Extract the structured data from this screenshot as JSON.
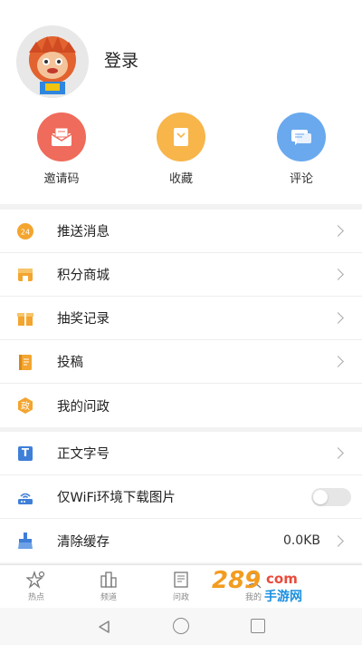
{
  "profile": {
    "login_label": "登录"
  },
  "quick_actions": [
    {
      "label": "邀请码",
      "icon": "envelope-icon",
      "color": "#ef6b5b"
    },
    {
      "label": "收藏",
      "icon": "bookmark-icon",
      "color": "#f7b54a"
    },
    {
      "label": "评论",
      "icon": "comment-icon",
      "color": "#6aa9ee"
    }
  ],
  "menu_group1": [
    {
      "label": "推送消息",
      "icon": "clock-24-icon"
    },
    {
      "label": "积分商城",
      "icon": "store-icon"
    },
    {
      "label": "抽奖记录",
      "icon": "gift-icon"
    },
    {
      "label": "投稿",
      "icon": "notebook-icon"
    },
    {
      "label": "我的问政",
      "icon": "politics-icon",
      "icon_text": "政"
    }
  ],
  "menu_group2": [
    {
      "label": "正文字号",
      "icon": "font-size-icon",
      "icon_text": "T"
    },
    {
      "label": "仅WiFi环境下载图片",
      "icon": "wifi-router-icon"
    },
    {
      "label": "清除缓存",
      "icon": "brush-icon",
      "value": "0.0KB"
    }
  ],
  "tabs": [
    {
      "label": "热点",
      "icon": "hot-icon"
    },
    {
      "label": "频道",
      "icon": "channel-icon"
    },
    {
      "label": "问政",
      "icon": "question-icon"
    },
    {
      "label": "我的",
      "icon": "user-icon"
    }
  ],
  "watermark": {
    "text": "289",
    "sub": "手游网",
    "suffix": "com"
  },
  "colors": {
    "accent_orange": "#f3a52f",
    "accent_blue": "#3f7fd8"
  }
}
